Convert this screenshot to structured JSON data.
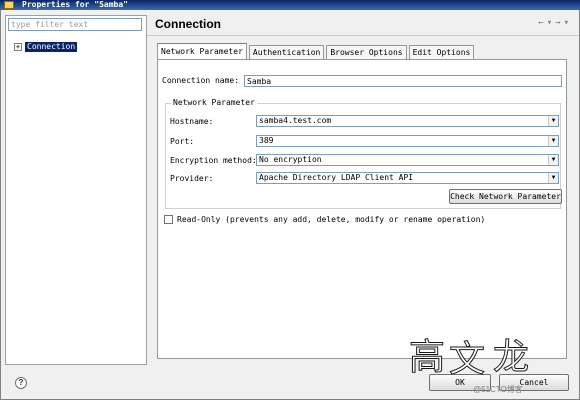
{
  "window": {
    "title": "Properties for \"Samba\""
  },
  "left_panel": {
    "filter_placeholder": "type filter text",
    "tree": [
      {
        "label": "Connection",
        "expander": "+"
      }
    ]
  },
  "header": {
    "title": "Connection",
    "nav": {
      "back": "←",
      "back_dropdown": "▾",
      "forward": "→",
      "forward_dropdown": "▾"
    }
  },
  "tabs": [
    "Network Parameter",
    "Authentication",
    "Browser Options",
    "Edit Options"
  ],
  "form": {
    "connection_name_label": "Connection name:",
    "connection_name_value": "Samba",
    "group_title": "Network Parameter",
    "hostname_label": "Hostname:",
    "hostname_value": "samba4.test.com",
    "port_label": "Port:",
    "port_value": "389",
    "encryption_label": "Encryption method:",
    "encryption_value": "No encryption",
    "provider_label": "Provider:",
    "provider_value": "Apache Directory LDAP Client API",
    "check_button": "Check Network Parameter",
    "readonly_label": "Read-Only (prevents any add, delete, modify or rename operation)",
    "readonly_checked": false
  },
  "footer": {
    "help": "?",
    "ok": "OK",
    "cancel": "Cancel"
  },
  "watermark": {
    "chars": [
      "高",
      "文",
      "龙"
    ],
    "credit": "@51CTO博客"
  },
  "colors": {
    "selection": "#0a246a",
    "titlebar": "#0a246a",
    "dialog_bg": "#f0f0f0"
  }
}
